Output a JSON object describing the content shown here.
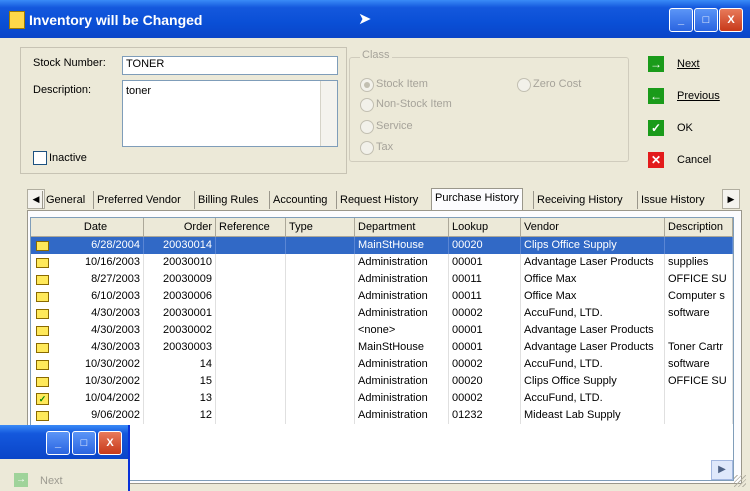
{
  "window": {
    "title": "Inventory will be Changed",
    "controls": [
      "_",
      "□",
      "X"
    ]
  },
  "form": {
    "stock_number_label": "Stock Number:",
    "stock_number_value": "TONER",
    "description_label": "Description:",
    "description_value": "toner",
    "inactive_label": "Inactive",
    "inactive_checked": false
  },
  "class_group": {
    "title": "Class",
    "options": [
      {
        "label": "Stock Item",
        "selected": true
      },
      {
        "label": "Non-Stock Item",
        "selected": false
      },
      {
        "label": "Service",
        "selected": false
      },
      {
        "label": "Tax",
        "selected": false
      },
      {
        "label": "Zero Cost",
        "selected": false
      }
    ]
  },
  "actions": {
    "next": "Next",
    "previous": "Previous",
    "ok": "OK",
    "cancel": "Cancel"
  },
  "tabs": [
    {
      "label": "General"
    },
    {
      "label": "Preferred Vendor"
    },
    {
      "label": "Billing Rules"
    },
    {
      "label": "Accounting"
    },
    {
      "label": "Request History"
    },
    {
      "label": "Purchase History",
      "active": true
    },
    {
      "label": "Receiving History"
    },
    {
      "label": "Issue History"
    }
  ],
  "table": {
    "columns": [
      "Date",
      "Order",
      "Reference",
      "Type",
      "Department",
      "Lookup",
      "Vendor",
      "Description"
    ],
    "rows": [
      {
        "date": "6/28/2004",
        "order": "20030014",
        "reference": "",
        "type": "",
        "department": "MainStHouse",
        "lookup": "00020",
        "vendor": "Clips Office Supply",
        "description": "",
        "selected": true
      },
      {
        "date": "10/16/2003",
        "order": "20030010",
        "reference": "",
        "type": "",
        "department": "Administration",
        "lookup": "00001",
        "vendor": "Advantage Laser Products",
        "description": "supplies"
      },
      {
        "date": "8/27/2003",
        "order": "20030009",
        "reference": "",
        "type": "",
        "department": "Administration",
        "lookup": "00011",
        "vendor": "Office Max",
        "description": "OFFICE SU"
      },
      {
        "date": "6/10/2003",
        "order": "20030006",
        "reference": "",
        "type": "",
        "department": "Administration",
        "lookup": "00011",
        "vendor": "Office Max",
        "description": "Computer s"
      },
      {
        "date": "4/30/2003",
        "order": "20030001",
        "reference": "",
        "type": "",
        "department": "Administration",
        "lookup": "00002",
        "vendor": "AccuFund, LTD.",
        "description": "software"
      },
      {
        "date": "4/30/2003",
        "order": "20030002",
        "reference": "",
        "type": "",
        "department": "<none>",
        "lookup": "00001",
        "vendor": "Advantage Laser Products",
        "description": ""
      },
      {
        "date": "4/30/2003",
        "order": "20030003",
        "reference": "",
        "type": "",
        "department": "MainStHouse",
        "lookup": "00001",
        "vendor": "Advantage Laser Products",
        "description": "Toner Cartr"
      },
      {
        "date": "10/30/2002",
        "order": "14",
        "reference": "",
        "type": "",
        "department": "Administration",
        "lookup": "00002",
        "vendor": "AccuFund, LTD.",
        "description": "software"
      },
      {
        "date": "10/30/2002",
        "order": "15",
        "reference": "",
        "type": "",
        "department": "Administration",
        "lookup": "00020",
        "vendor": "Clips Office Supply",
        "description": "OFFICE SU"
      },
      {
        "date": "10/04/2002",
        "order": "13",
        "reference": "",
        "type": "",
        "department": "Administration",
        "lookup": "00002",
        "vendor": "AccuFund, LTD.",
        "description": "",
        "icon": "folder-check"
      },
      {
        "date": "9/06/2002",
        "order": "12",
        "reference": "",
        "type": "",
        "department": "Administration",
        "lookup": "01232",
        "vendor": "Mideast Lab Supply",
        "description": ""
      }
    ]
  },
  "second_window": {
    "next_label": "Next"
  },
  "colors": {
    "title_bar": "#0a4fd6",
    "selection": "#3169c6",
    "face": "#ece9d8"
  }
}
